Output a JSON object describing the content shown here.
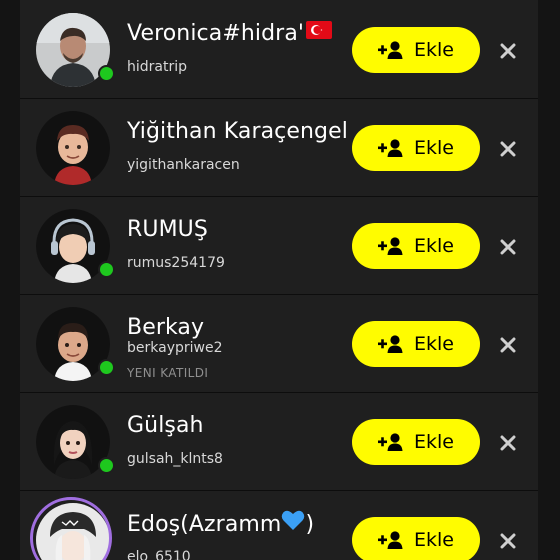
{
  "add_label": "Ekle",
  "colors": {
    "add_button": "#fffc00",
    "online": "#1ec81e",
    "story_ring": "#a06ee0"
  },
  "suggestions": [
    {
      "display_name": "Veronica#hidra'",
      "username": "hidratrip",
      "online": true,
      "flag": "turkey-flag-icon"
    },
    {
      "display_name": "Yiğithan Karaçengel",
      "username": "yigithankaracen",
      "online": false
    },
    {
      "display_name": "RUMUŞ",
      "username": "rumus254179",
      "online": true
    },
    {
      "display_name": "Berkay",
      "username": "berkaypriwe2",
      "status": "YENI KATILDI",
      "online": true
    },
    {
      "display_name": "Gülşah",
      "username": "gulsah_klnts8",
      "online": true
    },
    {
      "display_name": "Edoş(Azramm",
      "username": "elo_6510",
      "online": false,
      "heart": "blue-heart-icon",
      "display_name_end": ")"
    }
  ]
}
